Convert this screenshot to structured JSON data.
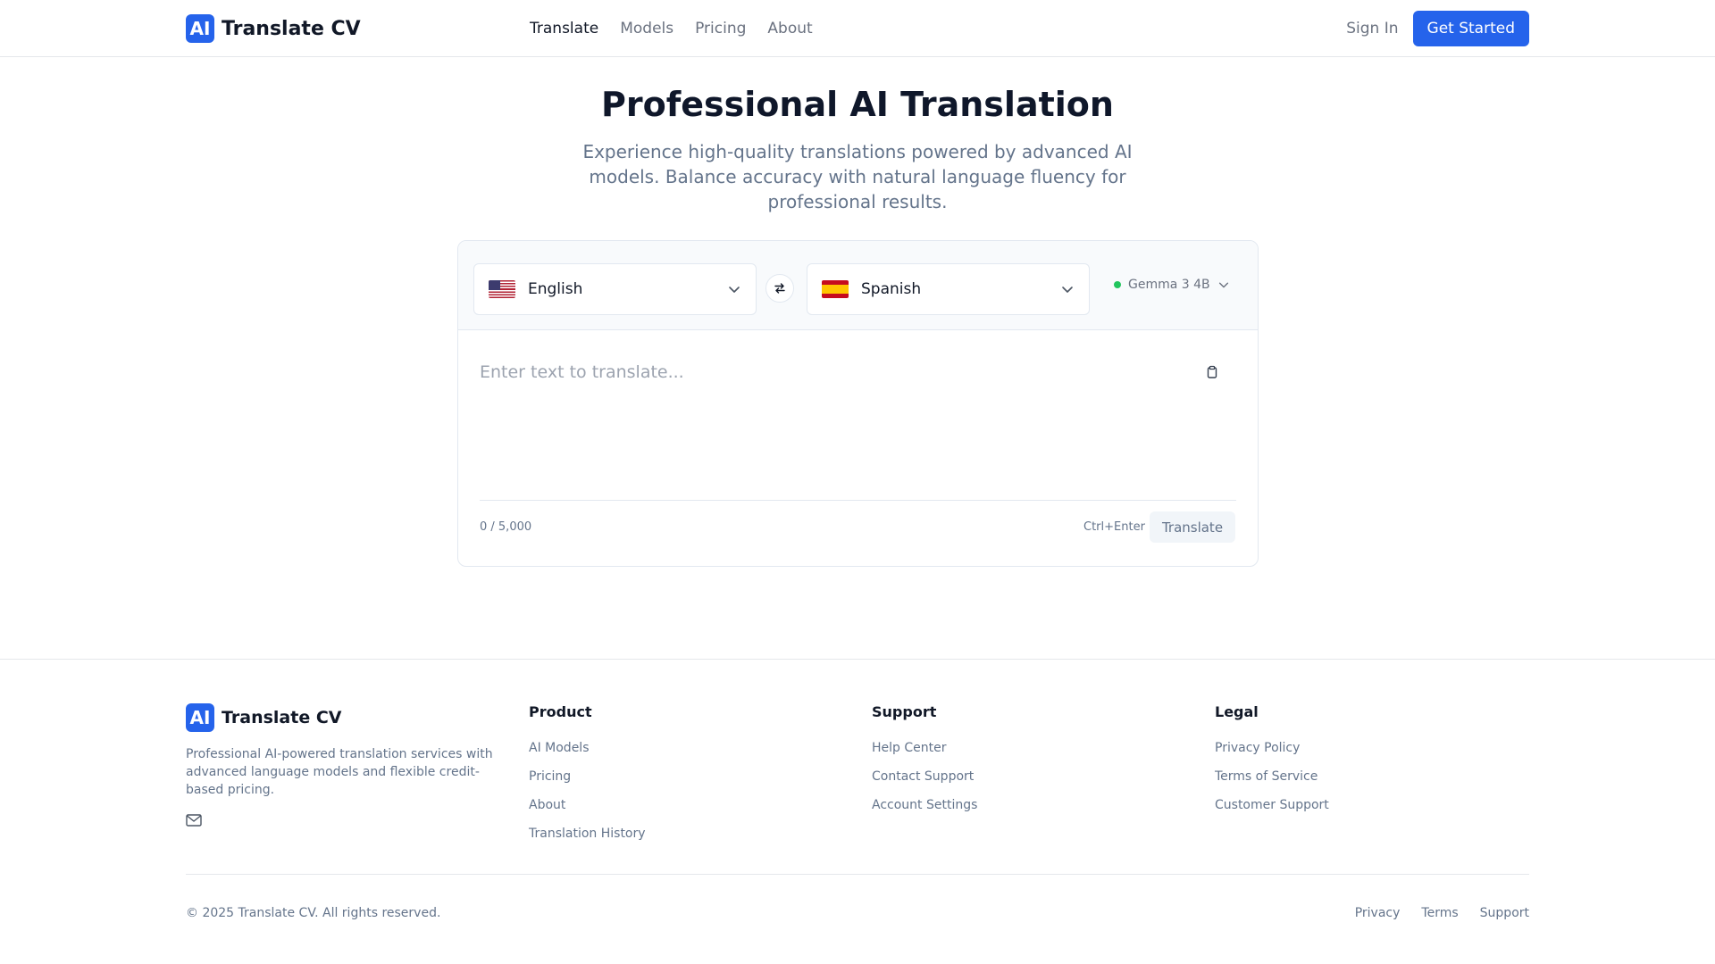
{
  "header": {
    "logo": "AI",
    "brand": "Translate CV",
    "nav": [
      {
        "label": "Translate",
        "active": true
      },
      {
        "label": "Models",
        "active": false
      },
      {
        "label": "Pricing",
        "active": false
      },
      {
        "label": "About",
        "active": false
      }
    ],
    "sign_in": "Sign In",
    "get_started": "Get Started"
  },
  "hero": {
    "title": "Professional AI Translation",
    "subtitle": "Experience high-quality translations powered by advanced AI models. Balance accuracy with natural language fluency for professional results."
  },
  "translator": {
    "source_language": "English",
    "target_language": "Spanish",
    "model": "Gemma 3 4B",
    "model_status_color": "#22c55e",
    "input_placeholder": "Enter text to translate...",
    "counter": "0 / 5,000",
    "shortcut": "Ctrl+Enter",
    "translate_label": "Translate"
  },
  "footer": {
    "logo": "AI",
    "brand": "Translate CV",
    "description": "Professional AI-powered translation services with advanced language models and flexible credit-based pricing.",
    "columns": [
      {
        "title": "Product",
        "links": [
          "AI Models",
          "Pricing",
          "About",
          "Translation History"
        ]
      },
      {
        "title": "Support",
        "links": [
          "Help Center",
          "Contact Support",
          "Account Settings"
        ]
      },
      {
        "title": "Legal",
        "links": [
          "Privacy Policy",
          "Terms of Service",
          "Customer Support"
        ]
      }
    ],
    "copyright": "© 2025 Translate CV. All rights reserved.",
    "bottom_links": [
      "Privacy",
      "Terms",
      "Support"
    ]
  },
  "colors": {
    "accent": "#2563eb",
    "muted_text": "#64748b"
  }
}
